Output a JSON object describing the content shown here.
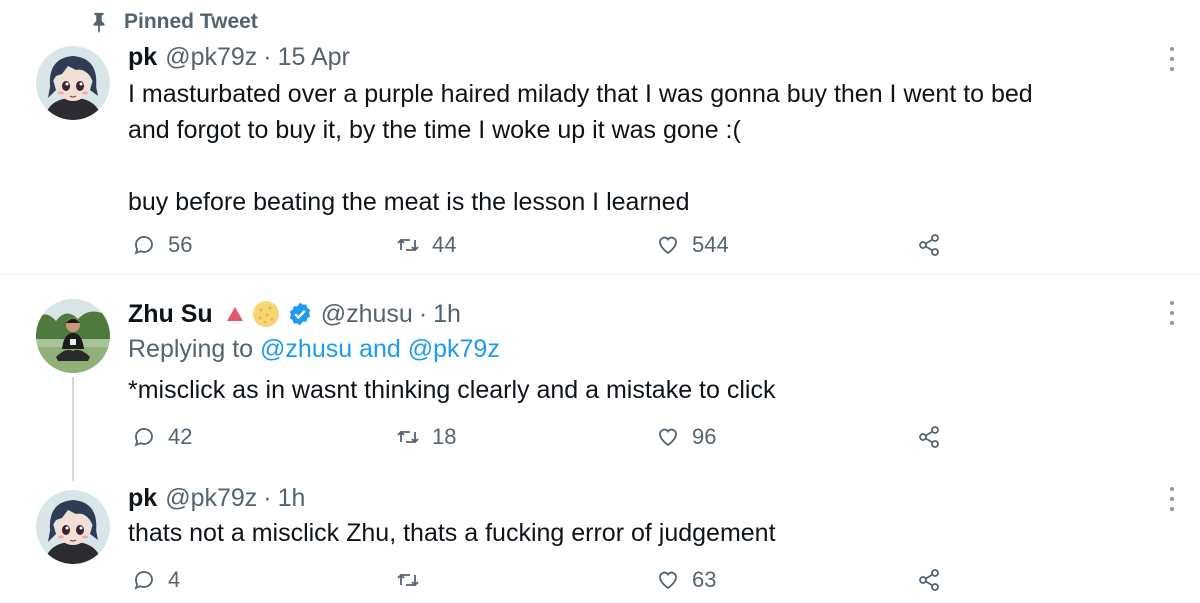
{
  "pinned_label": "Pinned Tweet",
  "tweets": [
    {
      "name": "pk",
      "handle": "@pk79z",
      "separator": "·",
      "time": "15 Apr",
      "text": "I masturbated over a purple haired milady that I was gonna buy then I went to bed\nand forgot to buy it, by the time I woke up it was gone :(\n\nbuy before beating the meat is the lesson I learned",
      "replies": "56",
      "retweets": "44",
      "likes": "544"
    },
    {
      "name": "Zhu Su",
      "handle": "@zhusu",
      "separator": "·",
      "time": "1h",
      "replying_prefix": "Replying to",
      "replying_user1": "@zhusu",
      "replying_and": "and",
      "replying_user2": "@pk79z",
      "text": "*misclick as in wasnt thinking clearly and a mistake to click",
      "replies": "42",
      "retweets": "18",
      "likes": "96"
    },
    {
      "name": "pk",
      "handle": "@pk79z",
      "separator": "·",
      "time": "1h",
      "text": "thats not a misclick Zhu, thats a fucking error of judgement",
      "replies": "4",
      "retweets": "",
      "likes": "63"
    }
  ],
  "colors": {
    "text": "#0f1419",
    "secondary": "#536471",
    "link": "#1d9bf0",
    "verified": "#1d9bf0",
    "triangle_badge": "#e05a6d",
    "divider": "#eff3f4"
  },
  "icons": [
    "pin-icon",
    "reply-icon",
    "retweet-icon",
    "like-icon",
    "share-icon",
    "more-icon",
    "verified-icon"
  ]
}
